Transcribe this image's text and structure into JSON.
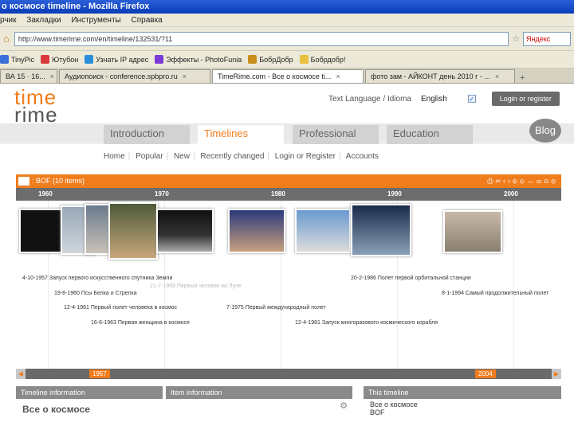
{
  "browser": {
    "title": "о космосе timeline - Mozilla Firefox",
    "menu": [
      "рчик",
      "Закладки",
      "Инструменты",
      "Справка"
    ],
    "url": "http://www.timerime.com/en/timeline/132531/?11",
    "search_placeholder": "Яндекс",
    "bookmarks": [
      {
        "label": "TinyPic",
        "color": "#3a6ed8"
      },
      {
        "label": "Ютубон",
        "color": "#d83a3a"
      },
      {
        "label": "Узнать IP адрес",
        "color": "#2a8fd8"
      },
      {
        "label": "Эффекты - PhotoFunia",
        "color": "#7a3ad8"
      },
      {
        "label": "БобрДобр",
        "color": "#c8901a"
      },
      {
        "label": "Бобрдобр!",
        "color": "#e8c040"
      }
    ],
    "tabs": [
      {
        "label": "ВА 15 · 16...",
        "active": false
      },
      {
        "label": "Аудиопоиск - conference.spbpro.ru",
        "active": false
      },
      {
        "label": "TimeRime.com - Все о космосе ti...",
        "active": true
      },
      {
        "label": "фото зам - АЙКОНТ день 2010 г - ...",
        "active": false
      }
    ]
  },
  "site": {
    "logo_top": "time",
    "logo_bottom": "rime",
    "top_right": {
      "text": "Text Language / Idioma",
      "language": "English",
      "login_button": "Login or register"
    },
    "main_tabs": [
      "Introduction",
      "Timelines",
      "Professional",
      "Education"
    ],
    "active_tab": "Timelines",
    "blog": "Blog",
    "subnav": [
      "Home",
      "Popular",
      "New",
      "Recently changed",
      "Login or Register",
      "Accounts"
    ]
  },
  "timeline": {
    "title": ": BOF (10 items)",
    "years": [
      "1960",
      "1970",
      "1980",
      "1990",
      "2000"
    ],
    "events": [
      {
        "text": "4-10-1957 Запуск первого искусственного спутника Земли"
      },
      {
        "text": "19-8-1960 Псы Белка и Стрелка"
      },
      {
        "text": "12-4-1961 Первый полет человека в космос"
      },
      {
        "text": "16-6-1963 Первая женщина в космосе"
      },
      {
        "text": "7-1975 Первый международный полет"
      },
      {
        "text": "12-4-1981 Запуск многоразового космического корабля"
      },
      {
        "text": "20-2-1986 Полет первой орбитальной станции"
      },
      {
        "text": "8-1-1994 Самый продолжительный полет"
      }
    ],
    "faint_events": [
      {
        "text": "21-7-1969 Первый человек на Луне"
      }
    ],
    "scroller": {
      "left_mark": "1957",
      "right_mark": "2004"
    }
  },
  "panels": {
    "timeline_info_header": "Timeline information",
    "timeline_name": "Все о космосе",
    "item_info_header": "Item information",
    "this_timeline_header": "This timeline",
    "this_timeline_lines": [
      "Все о космосе",
      "BOF"
    ]
  }
}
